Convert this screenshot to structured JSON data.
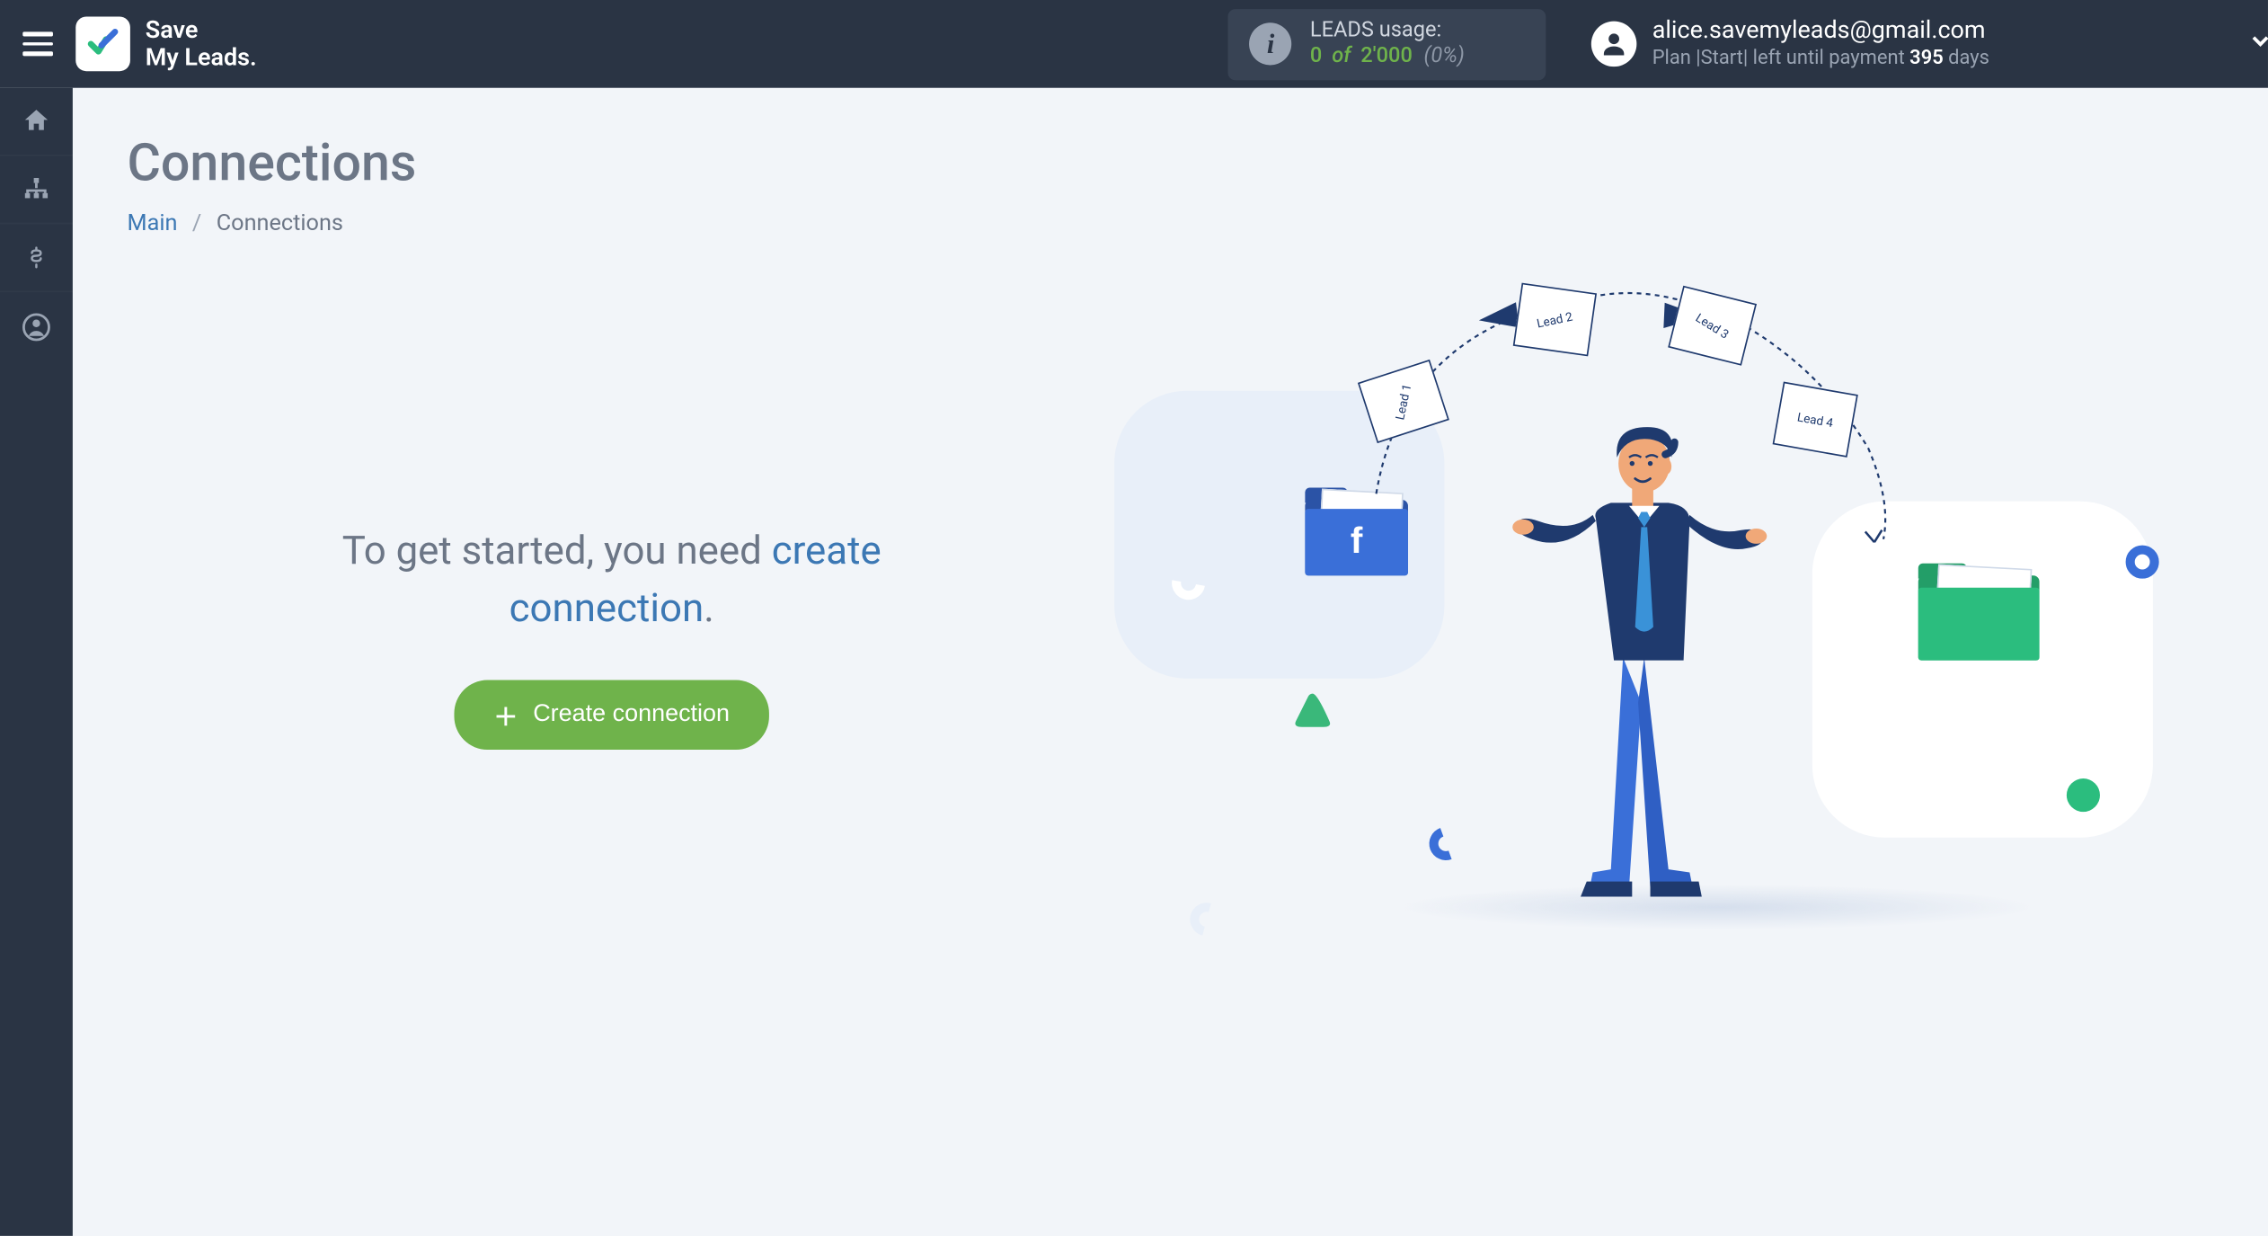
{
  "brand": {
    "line1": "Save",
    "line2": "My Leads."
  },
  "usage": {
    "title": "LEADS usage:",
    "current": "0",
    "of_word": "of",
    "total": "2'000",
    "percent": "(0%)"
  },
  "account": {
    "email": "alice.savemyleads@gmail.com",
    "plan_prefix": "Plan |",
    "plan_name": "Start",
    "plan_mid": "| left until payment",
    "days": "395",
    "days_suffix": "days"
  },
  "page": {
    "title": "Connections",
    "breadcrumb_main": "Main",
    "breadcrumb_current": "Connections"
  },
  "empty_state": {
    "line1": "To get started, you need ",
    "link_part": "create",
    "line2_link": "connection",
    "period": ".",
    "button": "Create connection"
  },
  "illustration": {
    "doc1": "Lead 1",
    "doc2": "Lead 2",
    "doc3": "Lead 3",
    "doc4": "Lead 4",
    "fb": "f"
  }
}
